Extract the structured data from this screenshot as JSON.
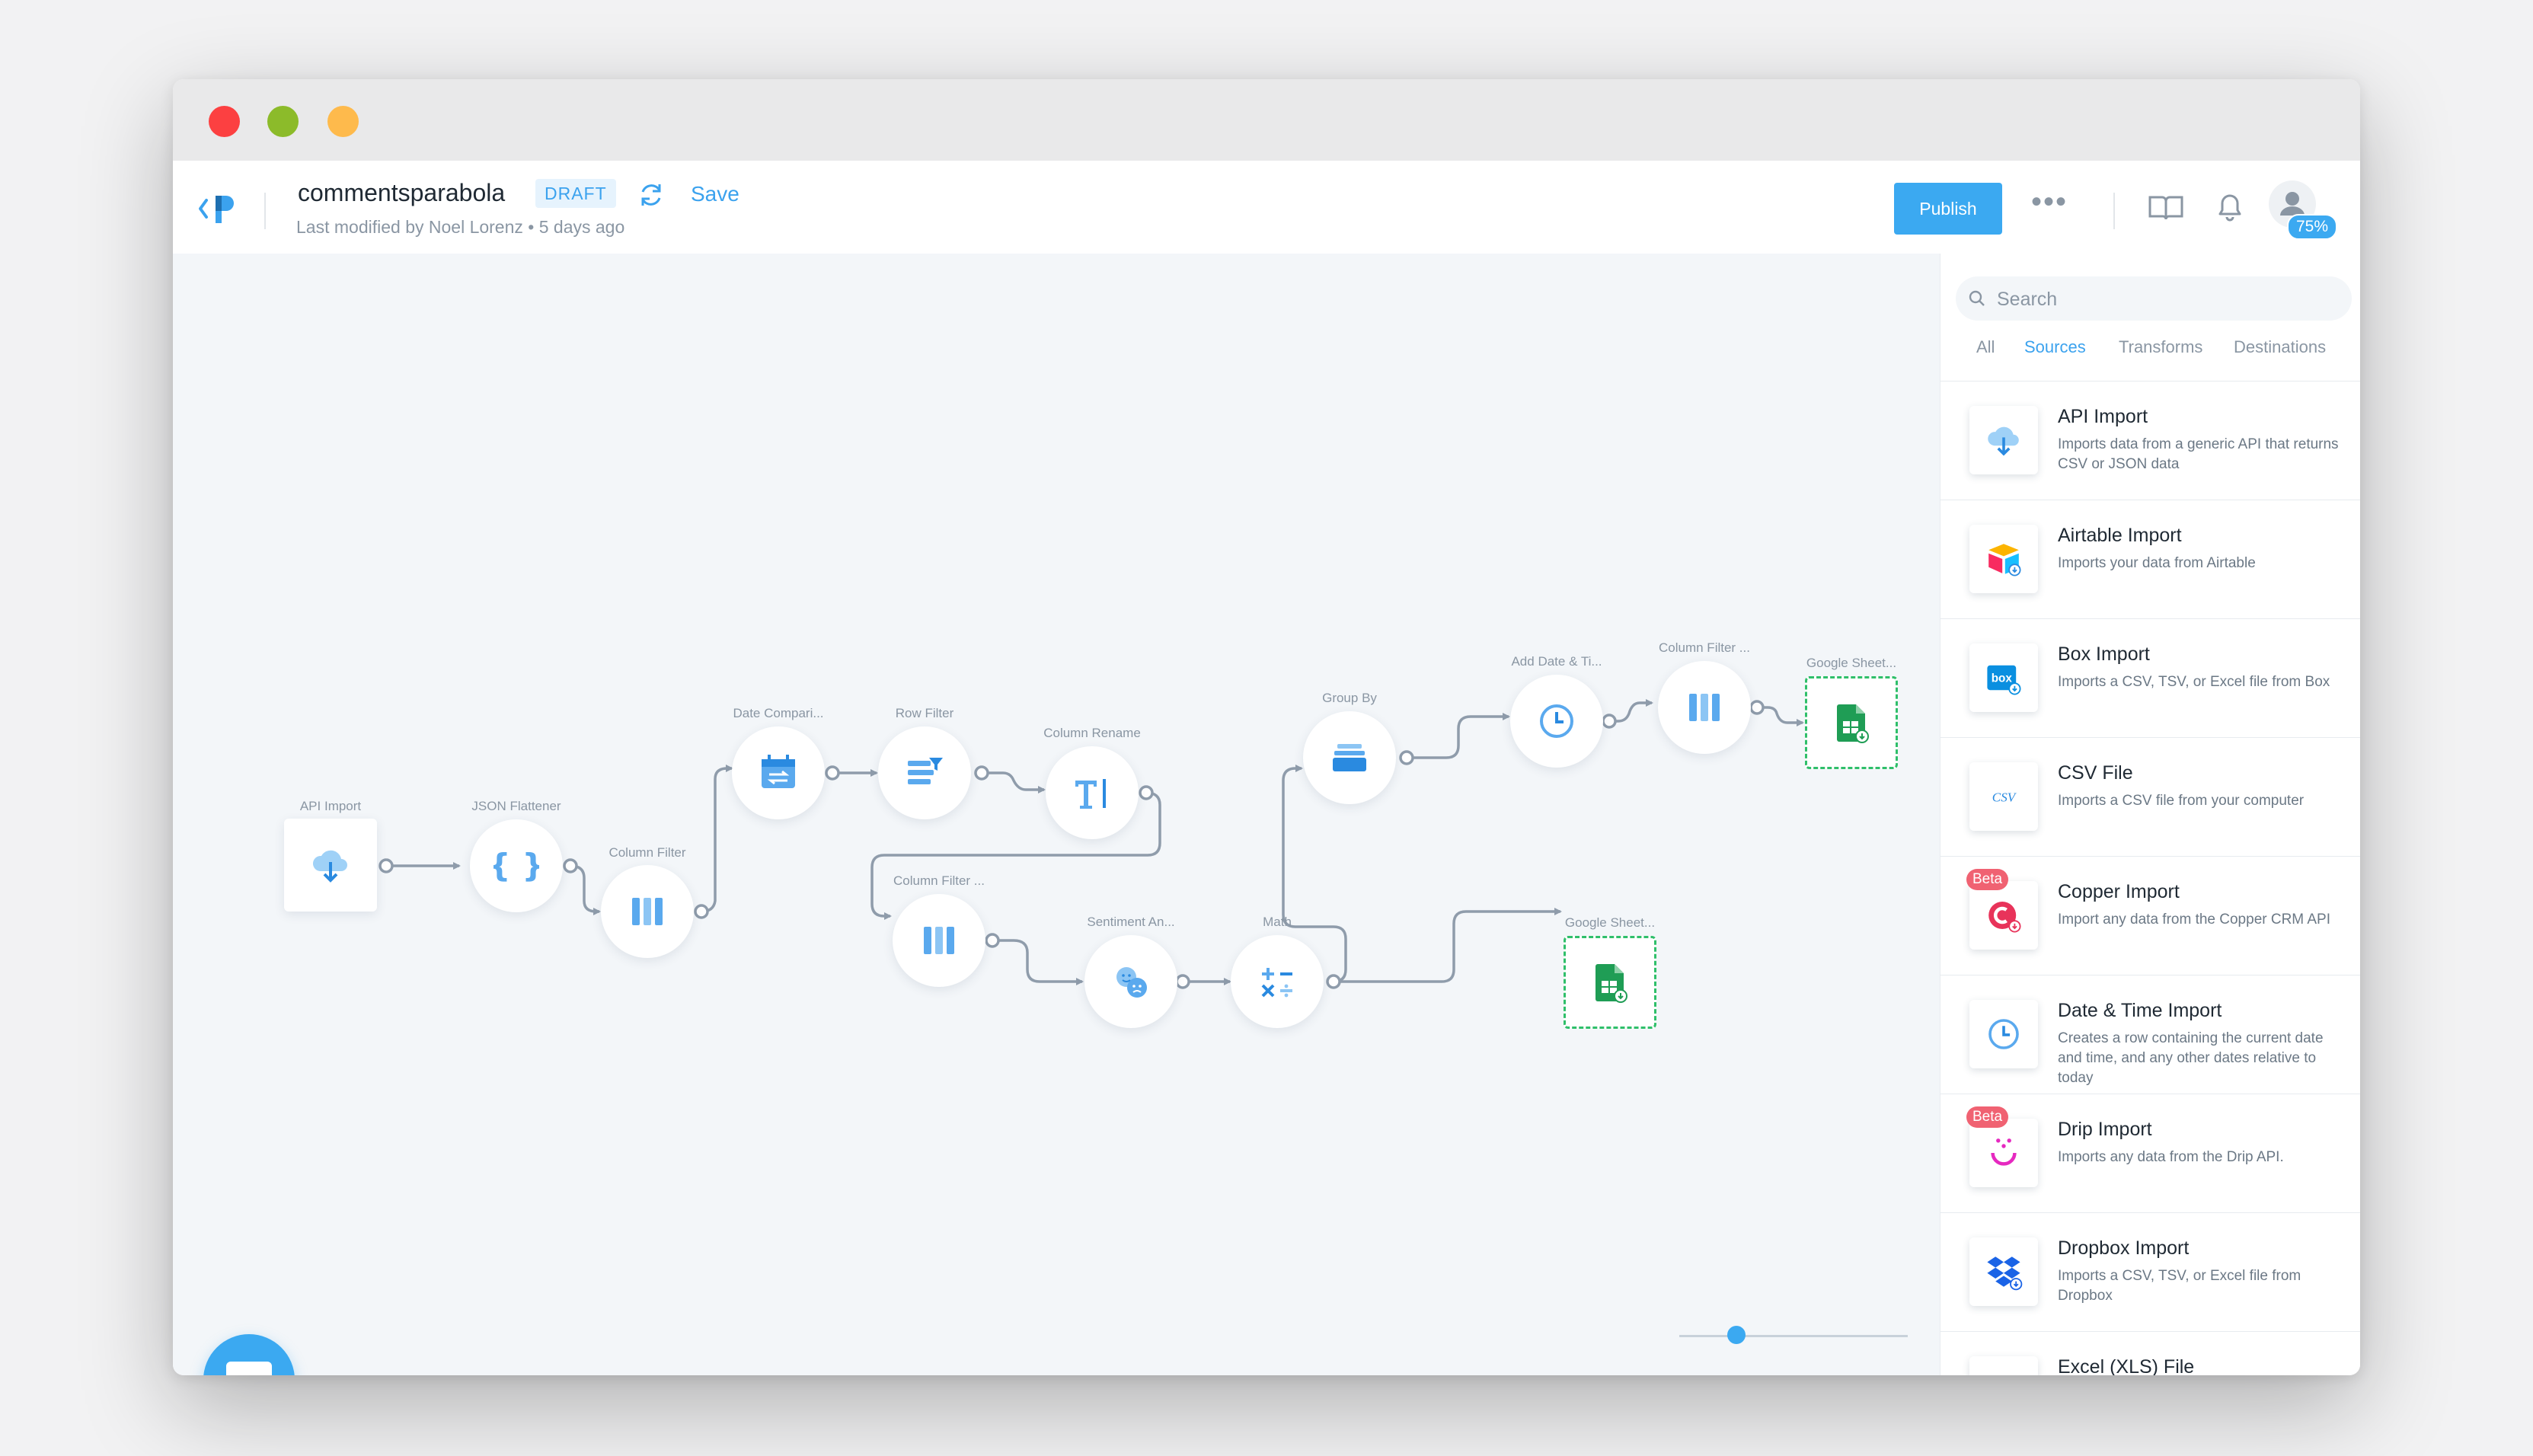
{
  "header": {
    "title": "commentsparabola",
    "status_badge": "DRAFT",
    "save_label": "Save",
    "modified_text": "Last modified by Noel Lorenz",
    "modified_time": "5 days ago",
    "publish_label": "Publish",
    "more_label": "•••",
    "zoom_badge": "75%"
  },
  "canvas": {
    "nodes": [
      {
        "id": "api-import",
        "label": "API Import",
        "icon": "cloud-download-icon"
      },
      {
        "id": "json-flattener",
        "label": "JSON Flattener",
        "icon": "braces-icon"
      },
      {
        "id": "column-filter-1",
        "label": "Column Filter",
        "icon": "columns-icon"
      },
      {
        "id": "date-compare",
        "label": "Date Compari...",
        "icon": "calendar-compare-icon"
      },
      {
        "id": "row-filter",
        "label": "Row Filter",
        "icon": "row-filter-icon"
      },
      {
        "id": "column-rename",
        "label": "Column Rename",
        "icon": "text-cursor-icon"
      },
      {
        "id": "column-filter-2",
        "label": "Column Filter ...",
        "icon": "columns-icon"
      },
      {
        "id": "sentiment",
        "label": "Sentiment An...",
        "icon": "faces-icon"
      },
      {
        "id": "math",
        "label": "Math",
        "icon": "math-icon"
      },
      {
        "id": "group-by",
        "label": "Group By",
        "icon": "stack-icon"
      },
      {
        "id": "add-date",
        "label": "Add Date & Ti...",
        "icon": "clock-icon"
      },
      {
        "id": "column-filter-3",
        "label": "Column Filter ...",
        "icon": "columns-icon"
      },
      {
        "id": "google-sheets-1",
        "label": "Google Sheet...",
        "icon": "google-sheets-icon"
      },
      {
        "id": "google-sheets-2",
        "label": "Google Sheet...",
        "icon": "google-sheets-icon"
      }
    ],
    "zoom_level": 0.25
  },
  "panel": {
    "search_placeholder": "Search",
    "tabs": [
      "All",
      "Sources",
      "Transforms",
      "Destinations"
    ],
    "active_tab": "Sources",
    "items": [
      {
        "name": "API Import",
        "desc": "Imports data from a generic API that returns CSV or JSON data",
        "icon": "cloud-download-icon",
        "beta": ""
      },
      {
        "name": "Airtable Import",
        "desc": "Imports your data from Airtable",
        "icon": "airtable-icon",
        "beta": ""
      },
      {
        "name": "Box Import",
        "desc": "Imports a CSV, TSV, or Excel file from Box",
        "icon": "box-icon",
        "beta": ""
      },
      {
        "name": "CSV File",
        "desc": "Imports a CSV file from your computer",
        "icon": "csv-icon",
        "beta": ""
      },
      {
        "name": "Copper Import",
        "desc": "Import any data from the Copper CRM API",
        "icon": "copper-icon",
        "beta": "Beta"
      },
      {
        "name": "Date & Time Import",
        "desc": "Creates a row containing the current date and time, and any other dates relative to today",
        "icon": "clock-icon",
        "beta": ""
      },
      {
        "name": "Drip Import",
        "desc": "Imports any data from the Drip API.",
        "icon": "drip-icon",
        "beta": "Beta"
      },
      {
        "name": "Dropbox Import",
        "desc": "Imports a CSV, TSV, or Excel file from Dropbox",
        "icon": "dropbox-icon",
        "beta": ""
      },
      {
        "name": "Excel (XLS) File",
        "desc": "",
        "icon": "excel-icon",
        "beta": ""
      }
    ],
    "csv_text": "CSV",
    "box_text": "box"
  },
  "colors": {
    "accent": "#3ba9f1",
    "edge": "#8f9cab",
    "sheets_green": "#1f9d55",
    "beta": "#f06272"
  }
}
